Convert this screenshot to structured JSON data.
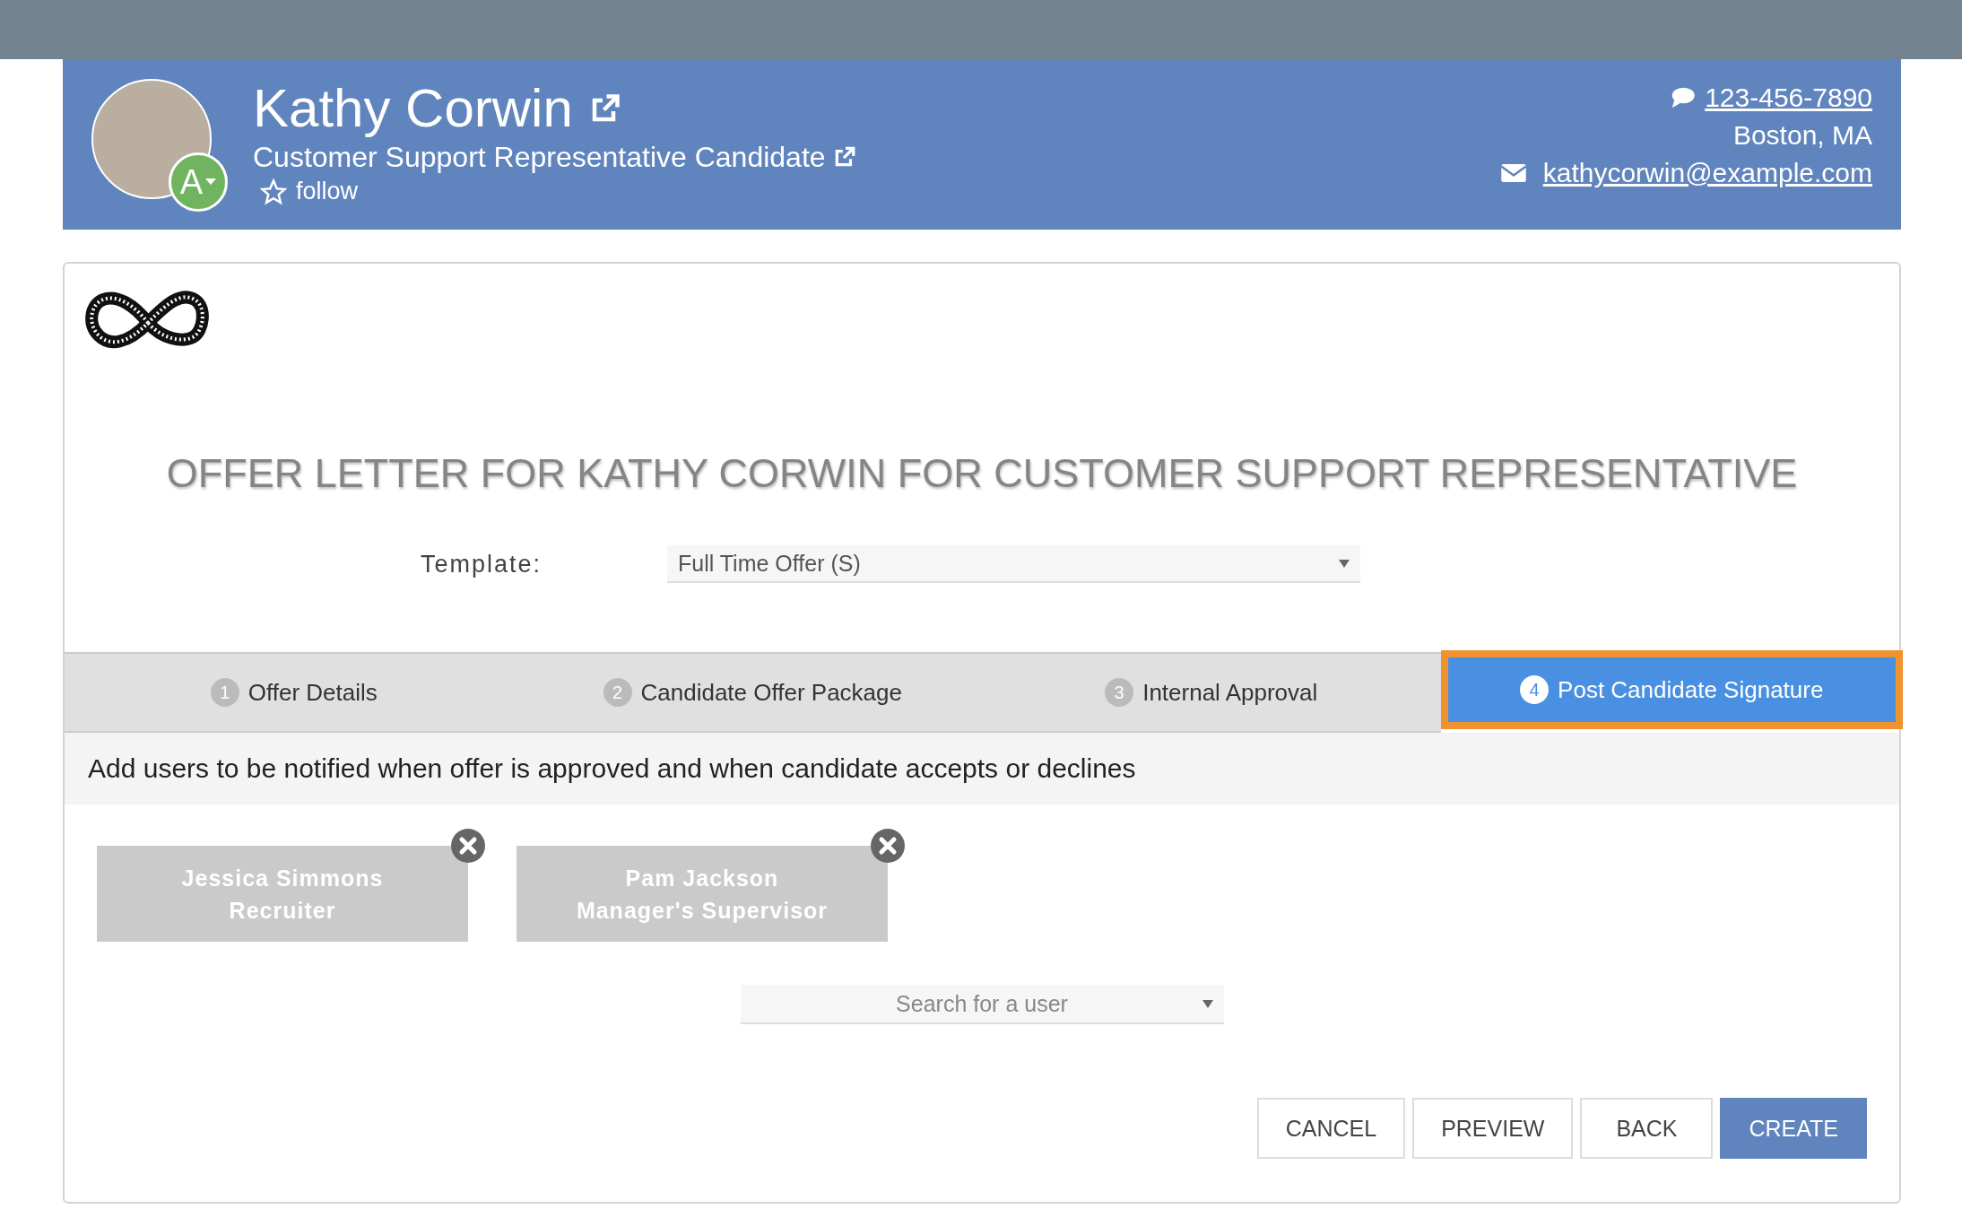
{
  "candidate": {
    "name": "Kathy Corwin",
    "title": "Customer Support Representative Candidate",
    "follow_label": "follow",
    "status_badge": "A",
    "phone": "123-456-7890",
    "location": "Boston, MA",
    "email": "kathycorwin@example.com"
  },
  "offer": {
    "heading": "OFFER LETTER FOR KATHY CORWIN FOR CUSTOMER SUPPORT REPRESENTATIVE",
    "template_label": "Template:",
    "template_value": "Full Time Offer (S)"
  },
  "steps": [
    {
      "number": "1",
      "label": "Offer Details",
      "selected": false
    },
    {
      "number": "2",
      "label": "Candidate Offer Package",
      "selected": false
    },
    {
      "number": "3",
      "label": "Internal Approval",
      "selected": false
    },
    {
      "number": "4",
      "label": "Post Candidate Signature",
      "selected": true
    }
  ],
  "notice": "Add users to be notified when offer is approved and when candidate accepts or declines",
  "users": [
    {
      "name": "Jessica Simmons",
      "role": "Recruiter"
    },
    {
      "name": "Pam Jackson",
      "role": "Manager's Supervisor"
    }
  ],
  "search": {
    "placeholder": "Search for a user"
  },
  "buttons": [
    {
      "label": "CANCEL",
      "kind": "secondary"
    },
    {
      "label": "PREVIEW",
      "kind": "secondary"
    },
    {
      "label": "BACK",
      "kind": "secondary"
    },
    {
      "label": "CREATE",
      "kind": "primary"
    }
  ]
}
